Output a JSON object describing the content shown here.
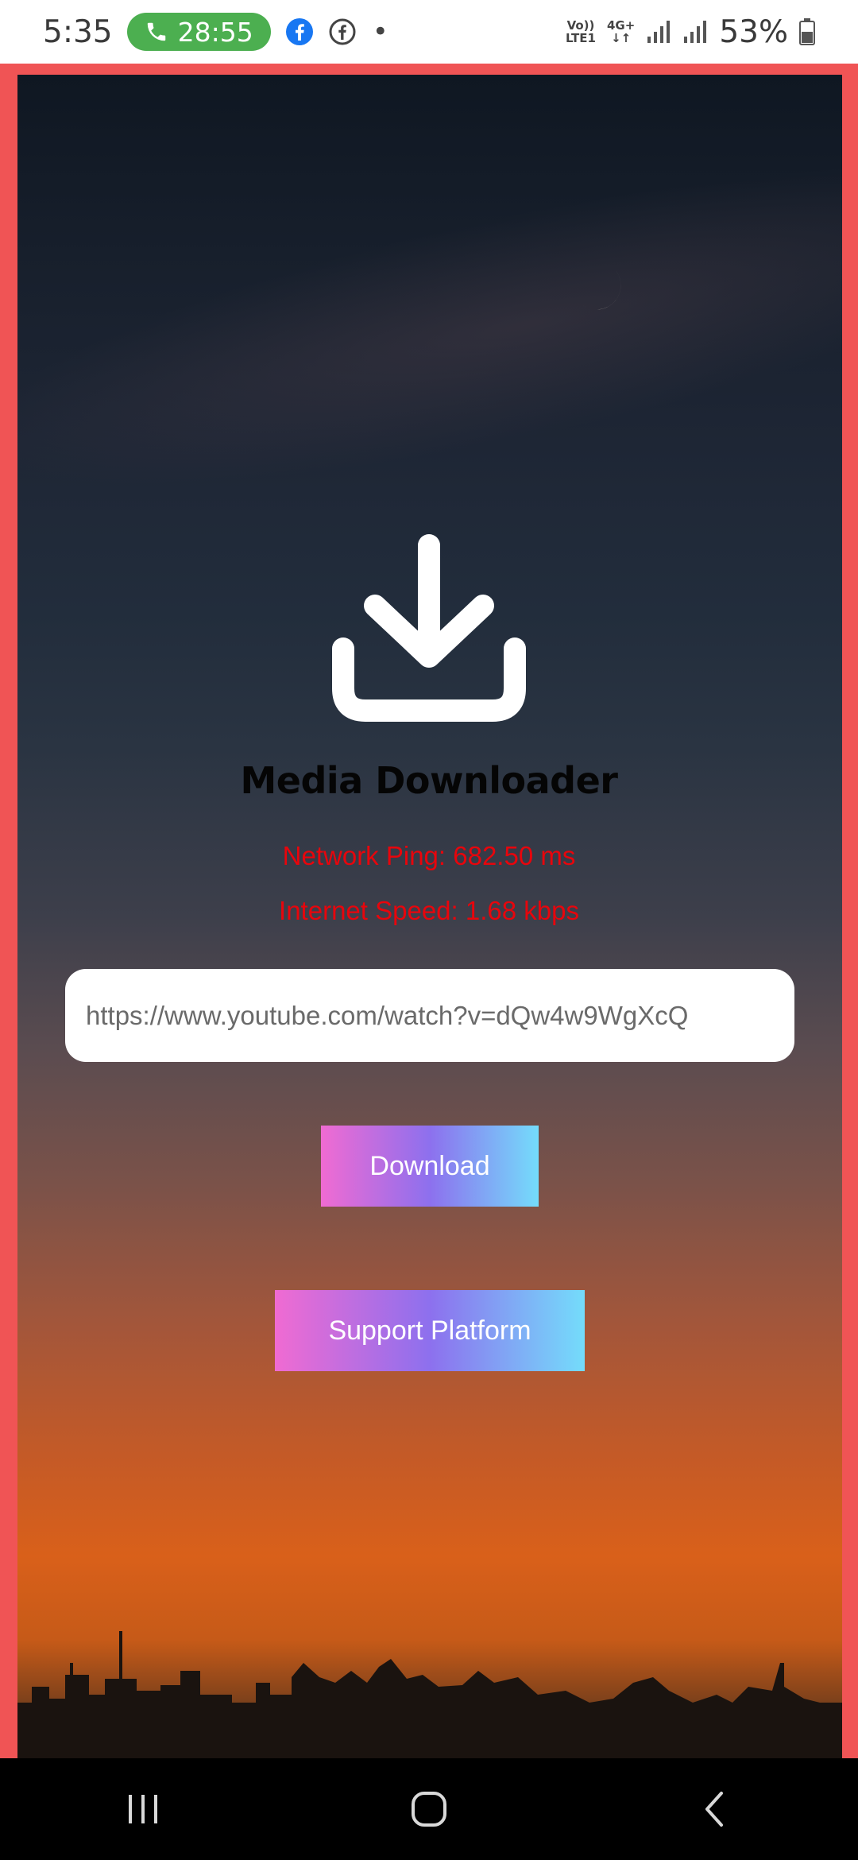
{
  "status_bar": {
    "time": "5:35",
    "call_duration": "28:55",
    "net_label_1_top": "Vo))",
    "net_label_1_bottom": "LTE1",
    "net_label_2_top": "4G+",
    "net_label_2_bottom": "↓↑",
    "battery": "53%",
    "icons": [
      "phone-icon",
      "facebook-icon",
      "messenger-icon",
      "signal-icon",
      "battery-icon"
    ]
  },
  "app": {
    "title": "Media Downloader",
    "network_ping": "Network Ping: 682.50 ms",
    "internet_speed": "Internet Speed: 1.68 kbps",
    "url_input_value": "https://www.youtube.com/watch?v=dQw4w9WgXcQ",
    "download_label": "Download",
    "support_label": "Support Platform"
  },
  "colors": {
    "frame": "#f05455",
    "metric_text": "#e8050c",
    "call_pill": "#4caf50",
    "button_gradient": [
      "#f06bd2",
      "#8d70ee",
      "#74dcfb"
    ]
  },
  "nav_bar": {
    "icons": [
      "recents-icon",
      "home-icon",
      "back-icon"
    ]
  }
}
